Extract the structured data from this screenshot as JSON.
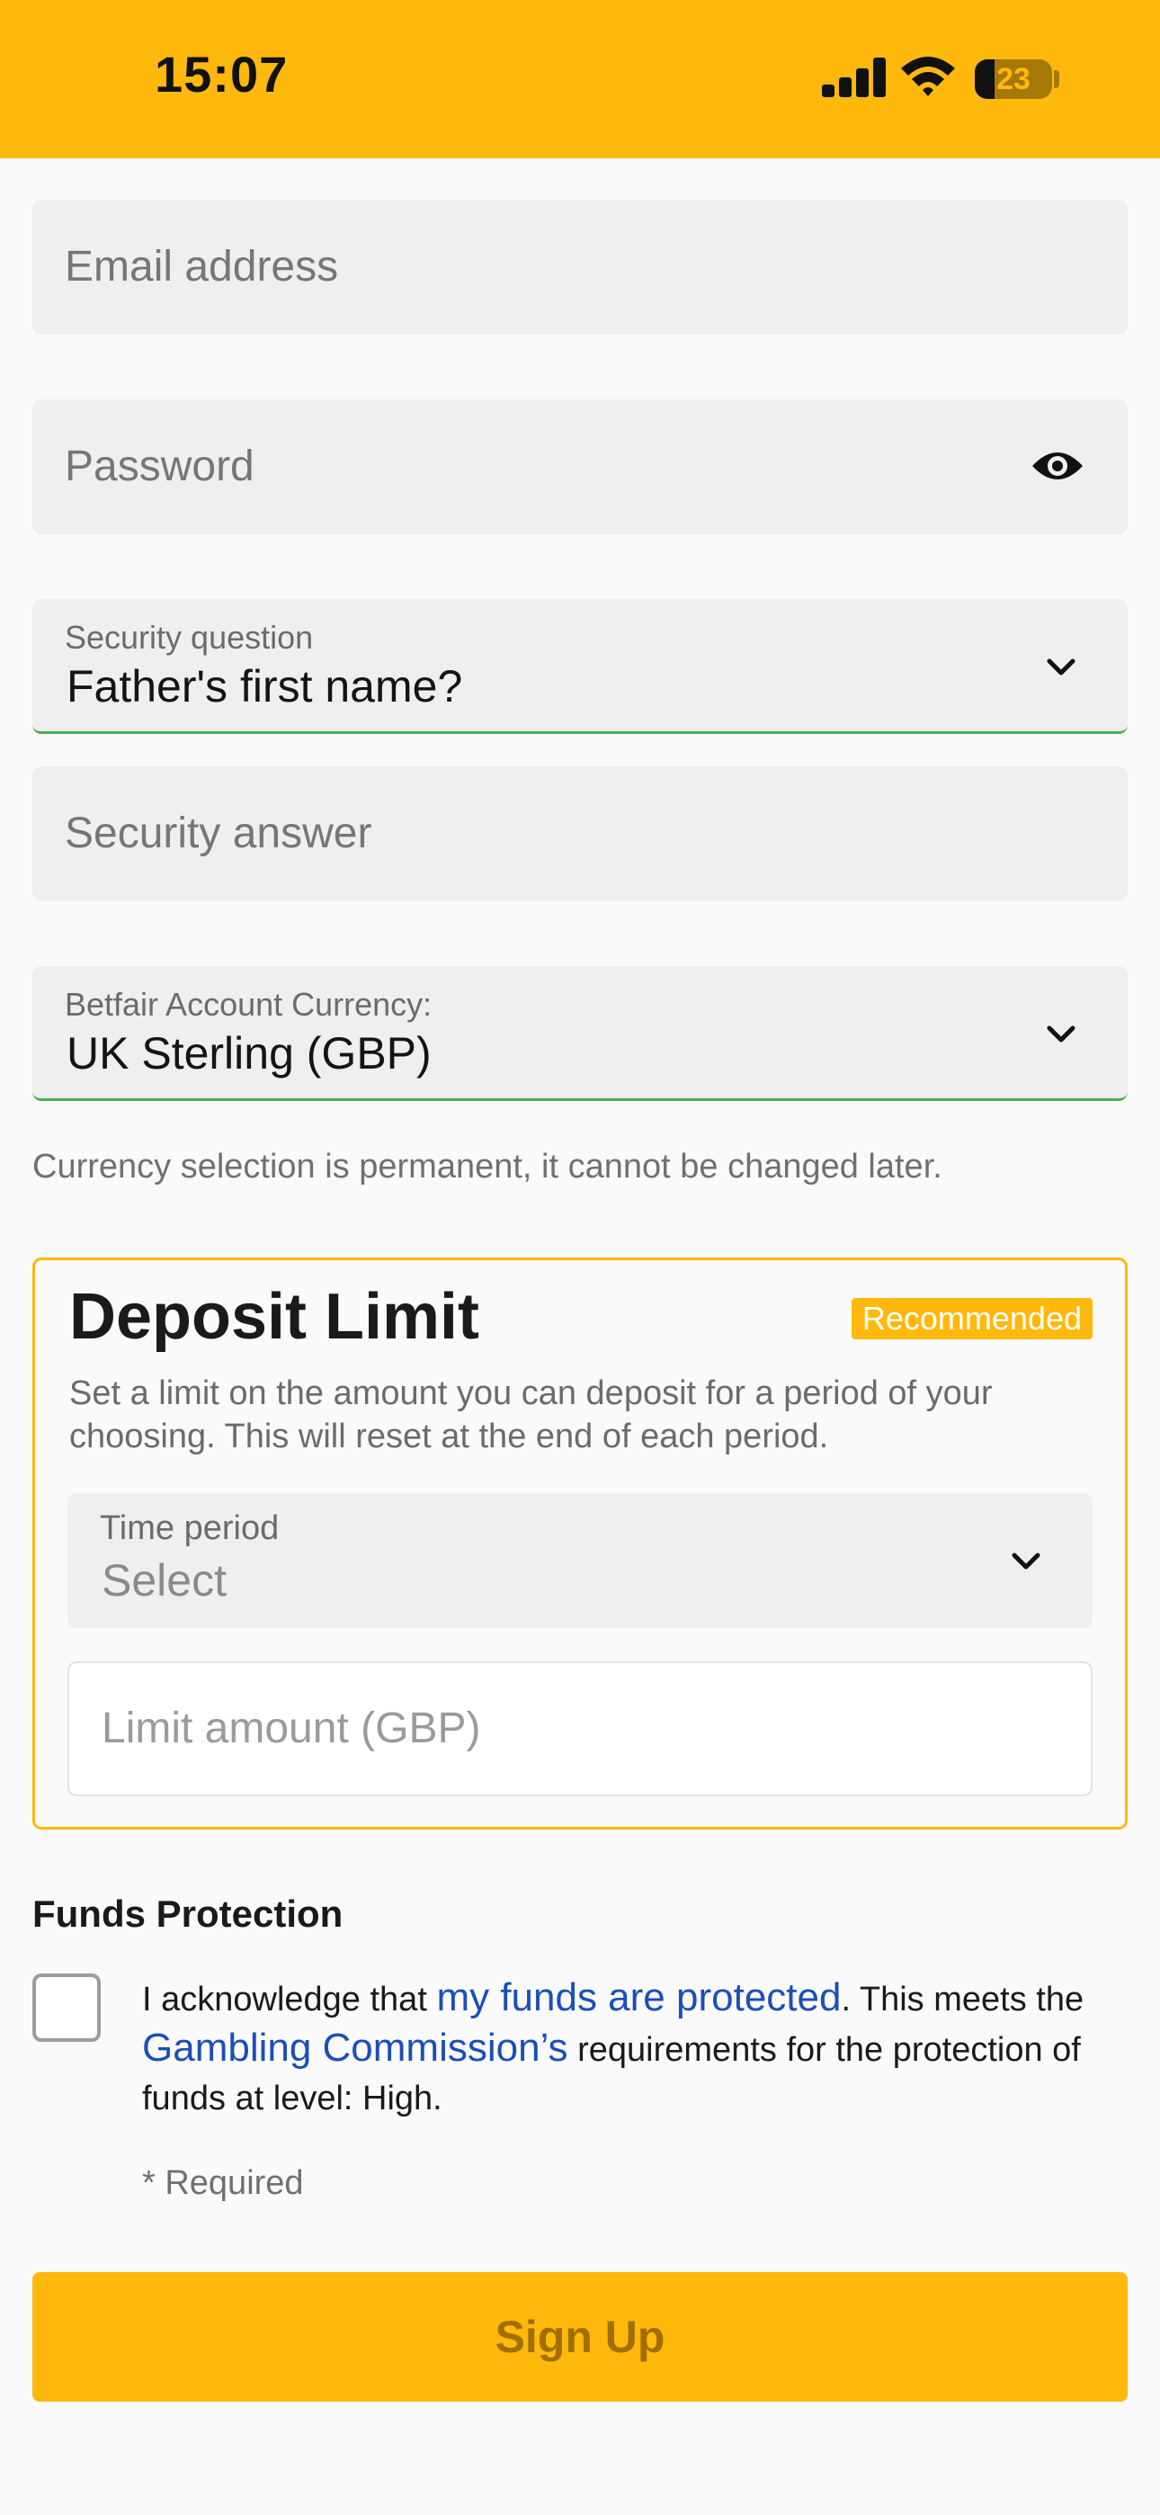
{
  "status_bar": {
    "time": "15:07",
    "battery": "23"
  },
  "form": {
    "email_placeholder": "Email address",
    "password_placeholder": "Password",
    "security_question": {
      "label": "Security question",
      "value": "Father's first name?"
    },
    "security_answer_placeholder": "Security answer",
    "currency": {
      "label": "Betfair Account Currency:",
      "value": "UK Sterling (GBP)"
    },
    "currency_note": "Currency selection is permanent, it cannot be changed later."
  },
  "deposit_limit": {
    "title": "Deposit Limit",
    "badge": "Recommended",
    "description": "Set a limit on the amount you can deposit for a period of your choosing. This will reset at the end of each period.",
    "time_period": {
      "label": "Time period",
      "value": "Select"
    },
    "limit_placeholder": "Limit amount (GBP)"
  },
  "funds_protection": {
    "title": "Funds Protection",
    "ack_prefix": "I acknowledge that ",
    "ack_link1": "my funds are protected",
    "ack_mid": ". This meets the ",
    "ack_link2": "Gambling Commission’s",
    "ack_suffix": " requirements for the protection of funds at level: High.",
    "required": "* Required"
  },
  "signup_label": "Sign Up",
  "colors": {
    "accent": "#ffb80c",
    "valid": "#4caf50",
    "link": "#1a4fb8"
  }
}
